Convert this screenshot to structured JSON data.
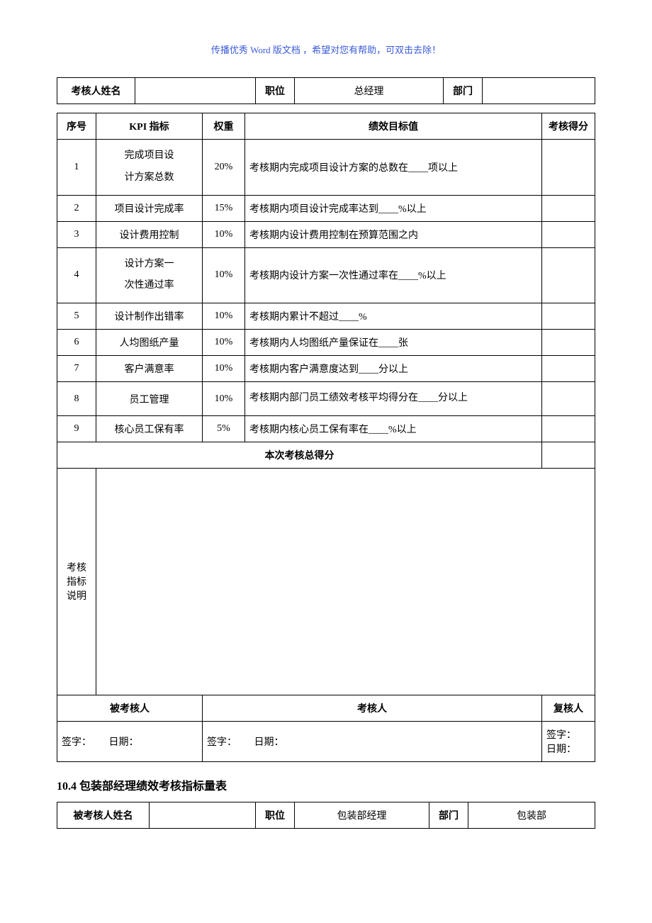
{
  "header_note": "传播优秀 Word 版文档 ，希望对您有帮助，可双击去除！",
  "info1": {
    "name_label": "考核人姓名",
    "name_value": "",
    "pos_label": "职位",
    "pos_value": "总经理",
    "dept_label": "部门",
    "dept_value": ""
  },
  "kpi": {
    "h_seq": "序号",
    "h_kpi": "KPI 指标",
    "h_weight": "权重",
    "h_target": "绩效目标值",
    "h_score": "考核得分",
    "rows": [
      {
        "seq": "1",
        "kpi_l1": "完成项目设",
        "kpi_l2": "计方案总数",
        "weight": "20%",
        "target": "考核期内完成项目设计方案的总数在____项以上",
        "score": ""
      },
      {
        "seq": "2",
        "kpi": "项目设计完成率",
        "weight": "15%",
        "target": "考核期内项目设计完成率达到____%以上",
        "score": ""
      },
      {
        "seq": "3",
        "kpi": "设计费用控制",
        "weight": "10%",
        "target": "考核期内设计费用控制在预算范围之内",
        "score": ""
      },
      {
        "seq": "4",
        "kpi_l1": "设计方案一",
        "kpi_l2": "次性通过率",
        "weight": "10%",
        "target": "考核期内设计方案一次性通过率在____%以上",
        "score": ""
      },
      {
        "seq": "5",
        "kpi": "设计制作出错率",
        "weight": "10%",
        "target": "考核期内累计不超过____%",
        "score": ""
      },
      {
        "seq": "6",
        "kpi": "人均图纸产量",
        "weight": "10%",
        "target": "考核期内人均图纸产量保证在____张",
        "score": ""
      },
      {
        "seq": "7",
        "kpi": "客户满意率",
        "weight": "10%",
        "target": "考核期内客户满意度达到____分以上",
        "score": ""
      },
      {
        "seq": "8",
        "kpi": "员工管理",
        "weight": "10%",
        "target": "考核期内部门员工绩效考核平均得分在____分以上",
        "score": ""
      },
      {
        "seq": "9",
        "kpi": "核心员工保有率",
        "weight": "5%",
        "target": "考核期内核心员工保有率在____%以上",
        "score": ""
      }
    ],
    "total_label": "本次考核总得分",
    "notes_l1": "考核",
    "notes_l2": "指标",
    "notes_l3": "说明",
    "role1": "被考核人",
    "role2": "考核人",
    "role3": "复核人",
    "sig_label": "签字：",
    "date_label": "日期："
  },
  "section_title": "10.4  包装部经理绩效考核指标量表",
  "info2": {
    "name_label": "被考核人姓名",
    "name_value": "",
    "pos_label": "职位",
    "pos_value": "包装部经理",
    "dept_label": "部门",
    "dept_value": "包装部"
  }
}
